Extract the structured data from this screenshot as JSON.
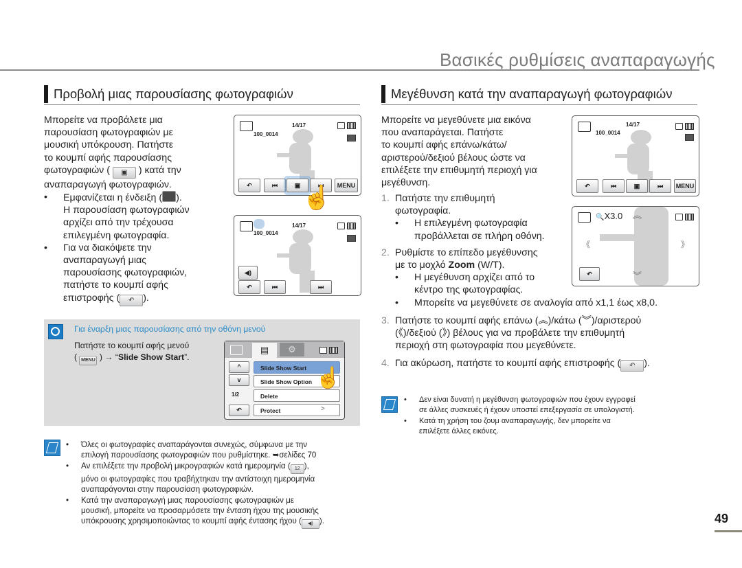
{
  "page": {
    "title": "Βασικές ρυθμίσεις αναπαραγωγής",
    "page_number": "49"
  },
  "left_section": {
    "heading": "Προβολή μιας παρουσίασης φωτογραφιών",
    "intro_lines": [
      "Μπορείτε να προβάλετε μια",
      "παρουσίαση φωτογραφιών με",
      "μουσική υπόκρουση. Πατήστε",
      "το κουμπί αφής παρουσίασης",
      "φωτογραφιών (",
      ") κατά την",
      "αναπαραγωγή φωτογραφιών."
    ],
    "bullets": [
      {
        "lines": [
          "Εμφανίζεται η ένδειξη (",
          ").",
          "Η παρουσίαση φωτογραφιών",
          "αρχίζει από την τρέχουσα",
          "επιλεγμένη φωτογραφία."
        ]
      },
      {
        "lines": [
          "Για να διακόψετε την",
          "αναπαραγωγή μιας",
          "παρουσίασης φωτογραφιών,",
          "πατήστε το κουμπί αφής",
          "επιστροφής (",
          ")."
        ]
      }
    ],
    "bullet_symbol": "•",
    "screen1": {
      "counter": "14/17",
      "file_name": "100_0014",
      "buttons": [
        "back",
        "prev",
        "slideshow",
        "next"
      ],
      "menu_label": "MENU"
    },
    "screen2": {
      "counter": "14/17",
      "file_name": "100_0014"
    },
    "tip": {
      "title": "Για έναρξη μιας παρουσίασης από την οθόνη μενού",
      "line1": "Πατήστε το κουμπί αφής μενού",
      "menu_key": "MENU",
      "arrow": "→",
      "quote_open": "“",
      "action": "Slide Show Start",
      "quote_close": "”.",
      "menu_screen": {
        "page_indicator": "1/2",
        "items": [
          {
            "label": "Slide Show Start",
            "selected": true
          },
          {
            "label": "Slide Show Option",
            "selected": false
          },
          {
            "label": "Delete",
            "selected": false
          },
          {
            "label": "Protect",
            "selected": false
          }
        ]
      }
    },
    "notes": [
      {
        "lines": [
          "Όλες οι φωτογραφίες αναπαράγονται συνεχώς, σύμφωνα με την",
          "επιλογή παρουσίασης φωτογραφιών που ρυθμίστηκε. ➥σελίδες 70"
        ]
      },
      {
        "lines": [
          "Αν επιλέξετε την προβολή μικρογραφιών κατά ημερομηνία (",
          "),",
          "μόνο οι φωτογραφίες που τραβήχτηκαν την αντίστοιχη ημερομηνία",
          "αναπαράγονται στην παρουσίαση φωτογραφιών."
        ]
      },
      {
        "lines": [
          "Κατά την αναπαραγωγή μιας παρουσίασης φωτογραφιών με",
          "μουσική, μπορείτε να προσαρμόσετε την ένταση ήχου της μουσικής",
          "υπόκρουσης χρησιμοποιώντας το κουμπί αφής έντασης ήχου (",
          ")."
        ]
      }
    ]
  },
  "right_section": {
    "heading": "Μεγέθυνση κατά την αναπαραγωγή φωτογραφιών",
    "intro_lines": [
      "Μπορείτε να μεγεθύνετε μια εικόνα",
      "που αναπαράγεται. Πατήστε",
      "το κουμπί αφής επάνω/κάτω/",
      "αριστερού/δεξιού βέλους ώστε να",
      "επιλέξετε την επιθυμητή περιοχή για",
      "μεγέθυνση."
    ],
    "steps": [
      {
        "num": "1.",
        "lines": [
          "Πατήστε την επιθυμητή",
          "φωτογραφία."
        ],
        "bullets": [
          [
            "Η επιλεγμένη φωτογραφία",
            "προβάλλεται σε πλήρη οθόνη."
          ]
        ]
      },
      {
        "num": "2.",
        "pre": "Ρυθμίστε το επίπεδο μεγέθυνσης",
        "line2_pre": "με το μοχλό ",
        "line2_bold": "Zoom",
        "line2_post": " (W/T).",
        "bullets": [
          [
            "Η μεγέθυνση αρχίζει από το",
            "κέντρο της φωτογραφίας."
          ],
          [
            "Μπορείτε να μεγεθύνετε σε αναλογία από x1,1 έως x8,0."
          ]
        ]
      },
      {
        "num": "3.",
        "lines": [
          "Πατήστε το κουμπί αφής επάνω (",
          ")/κάτω (",
          ")/αριστερού",
          "(",
          ")/δεξιού (",
          ") βέλους για να προβάλετε την επιθυμητή",
          "περιοχή στη φωτογραφία που μεγεθύνετε."
        ]
      },
      {
        "num": "4.",
        "lines": [
          "Για ακύρωση, πατήστε το κουμπί αφής επιστροφής (",
          ")."
        ]
      }
    ],
    "screen1": {
      "counter": "14/17",
      "file_name": "100_0014",
      "menu_label": "MENU"
    },
    "screen2": {
      "zoom_level": "X3.0"
    },
    "notes": [
      {
        "lines": [
          "Δεν είναι δυνατή η μεγέθυνση φωτογραφιών που έχουν εγγραφεί",
          "σε άλλες συσκευές ή έχουν υποστεί επεξεργασία σε υπολογιστή."
        ]
      },
      {
        "lines": [
          "Κατά τη χρήση του ζουμ αναπαραγωγής, δεν μπορείτε να",
          "επιλέξετε άλλες εικόνες."
        ]
      }
    ]
  },
  "icons": {
    "back": "↶",
    "prev": "⏮",
    "next": "⏭",
    "up": "︽",
    "down": "︾",
    "left": "《",
    "right": "》",
    "chevron_up": "^",
    "chevron_down": "v",
    "chevron_right": ">",
    "volume": "◀)",
    "magnifier": "🔍"
  }
}
